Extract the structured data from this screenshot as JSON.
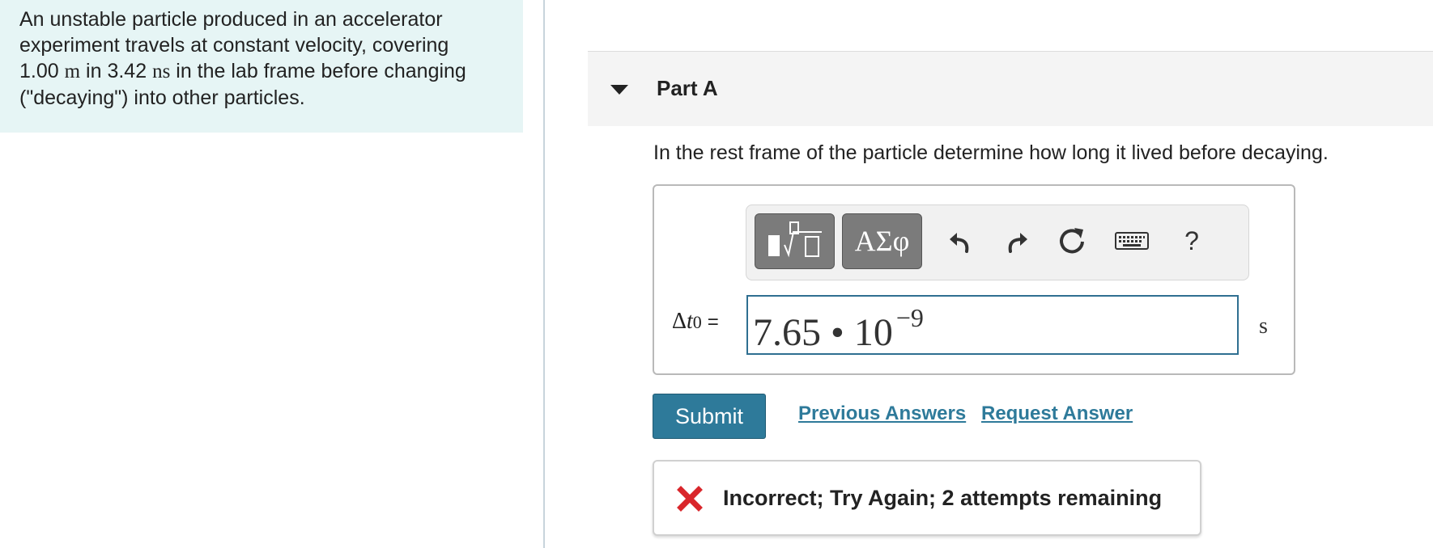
{
  "problem": {
    "line1": "An unstable particle produced in an accelerator",
    "line2": "experiment travels at constant velocity, covering",
    "line3_value1": "1.00",
    "line3_unit1": "m",
    "line3_mid": "in",
    "line3_value2": "3.42",
    "line3_unit2": "ns",
    "line3_end": "in the lab frame before changing",
    "line4": "(\"decaying\") into other particles."
  },
  "part": {
    "title": "Part A",
    "question": "In the rest frame of the particle determine how long it lived before decaying."
  },
  "toolbar": {
    "templates_icon": "templates-icon",
    "greek_label": "ΑΣφ",
    "undo_icon": "undo-icon",
    "redo_icon": "redo-icon",
    "reset_icon": "reset-icon",
    "keyboard_icon": "keyboard-icon",
    "help_label": "?"
  },
  "answer": {
    "label_delta": "Δ",
    "label_var": "t",
    "label_sub": "0",
    "label_eq": "=",
    "mantissa": "7.65",
    "times": "•",
    "base": "10",
    "exponent": "−9",
    "unit": "s"
  },
  "actions": {
    "submit_label": "Submit",
    "previous_answers_label": "Previous Answers",
    "request_answer_label": "Request Answer"
  },
  "feedback": {
    "icon": "x-icon",
    "message": "Incorrect; Try Again; 2 attempts remaining"
  },
  "colors": {
    "accent": "#2e7a9a",
    "error": "#d9262b",
    "panel_bg": "#e6f5f5"
  }
}
